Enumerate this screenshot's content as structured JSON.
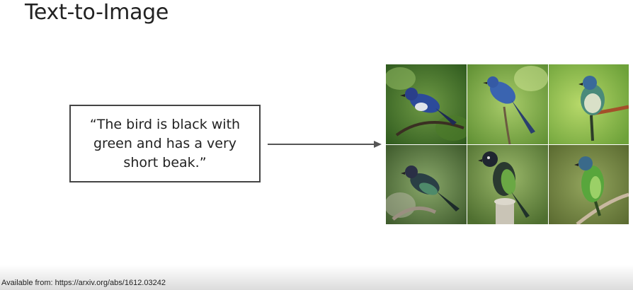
{
  "slide": {
    "title": "Text-to-Image",
    "prompt": "“The bird is black with green and has a very short beak.”",
    "source_note": "Available from: https://arxiv.org/abs/1612.03242"
  },
  "colors": {
    "text": "#222222",
    "box_border": "#444444",
    "arrow": "#555555"
  },
  "icons": {
    "arrow": "right-arrow-icon"
  },
  "images": [
    {
      "name": "bird-image-1"
    },
    {
      "name": "bird-image-2"
    },
    {
      "name": "bird-image-3"
    },
    {
      "name": "bird-image-4"
    },
    {
      "name": "bird-image-5"
    },
    {
      "name": "bird-image-6"
    }
  ]
}
